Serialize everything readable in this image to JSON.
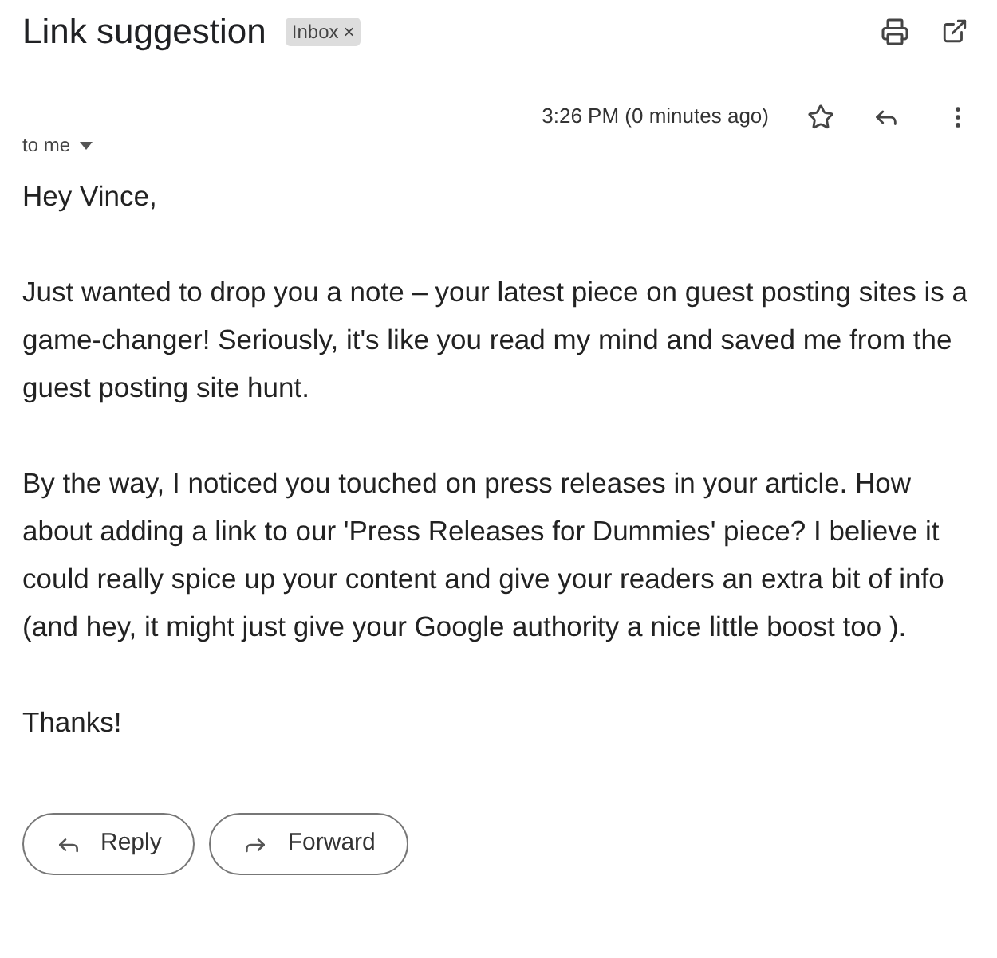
{
  "subject": "Link suggestion",
  "labels": [
    {
      "label": "Inbox",
      "remove": "×"
    }
  ],
  "time": "3:26 PM (0 minutes ago)",
  "starred": false,
  "recipient": "to me",
  "body": [
    "Hey Vince,",
    "Just wanted to drop you a note – your latest piece on guest posting sites is a game-changer! Seriously, it's like you read my mind and saved me from the guest posting site hunt.",
    "By the way, I noticed you touched on press releases in your article. How about adding a link to our 'Press Releases for Dummies' piece? I believe it could really spice up your content and give your readers an extra bit of info (and hey, it might just give your Google authority a nice little boost too ).",
    "Thanks!"
  ],
  "actions": [
    {
      "kind": "reply",
      "label": "Reply"
    },
    {
      "kind": "forward",
      "label": "Forward"
    }
  ]
}
